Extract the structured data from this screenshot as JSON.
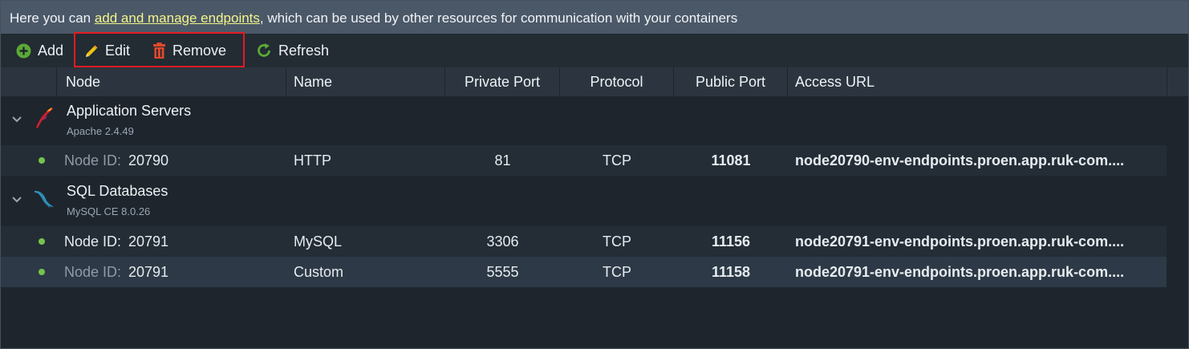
{
  "info": {
    "prefix": "Here you can ",
    "link": "add and manage endpoints",
    "suffix": ", which can be used by other resources for communication with your containers"
  },
  "toolbar": {
    "add_label": "Add",
    "edit_label": "Edit",
    "remove_label": "Remove",
    "refresh_label": "Refresh"
  },
  "columns": {
    "node": "Node",
    "name": "Name",
    "private_port": "Private Port",
    "protocol": "Protocol",
    "public_port": "Public Port",
    "access_url": "Access URL"
  },
  "groups": [
    {
      "title": "Application Servers",
      "subtitle": "Apache 2.4.49",
      "icon": "apache-feather-icon",
      "rows": [
        {
          "node_label": "Node ID:",
          "node_id": "20790",
          "name": "HTTP",
          "private_port": "81",
          "protocol": "TCP",
          "public_port": "11081",
          "access_url": "node20790-env-endpoints.proen.app.ruk-com...."
        }
      ]
    },
    {
      "title": "SQL Databases",
      "subtitle": "MySQL CE 8.0.26",
      "icon": "mysql-dolphin-icon",
      "rows": [
        {
          "node_label": "Node ID:",
          "node_id": "20791",
          "name": "MySQL",
          "private_port": "3306",
          "protocol": "TCP",
          "public_port": "11156",
          "access_url": "node20791-env-endpoints.proen.app.ruk-com...."
        },
        {
          "node_label": "Node ID:",
          "node_id": "20791",
          "name": "Custom",
          "private_port": "5555",
          "protocol": "TCP",
          "public_port": "11158",
          "access_url": "node20791-env-endpoints.proen.app.ruk-com...."
        }
      ]
    }
  ],
  "colors": {
    "accent_link": "#f3f58a",
    "status_running": "#74c44b",
    "highlight": "#e41b23"
  }
}
